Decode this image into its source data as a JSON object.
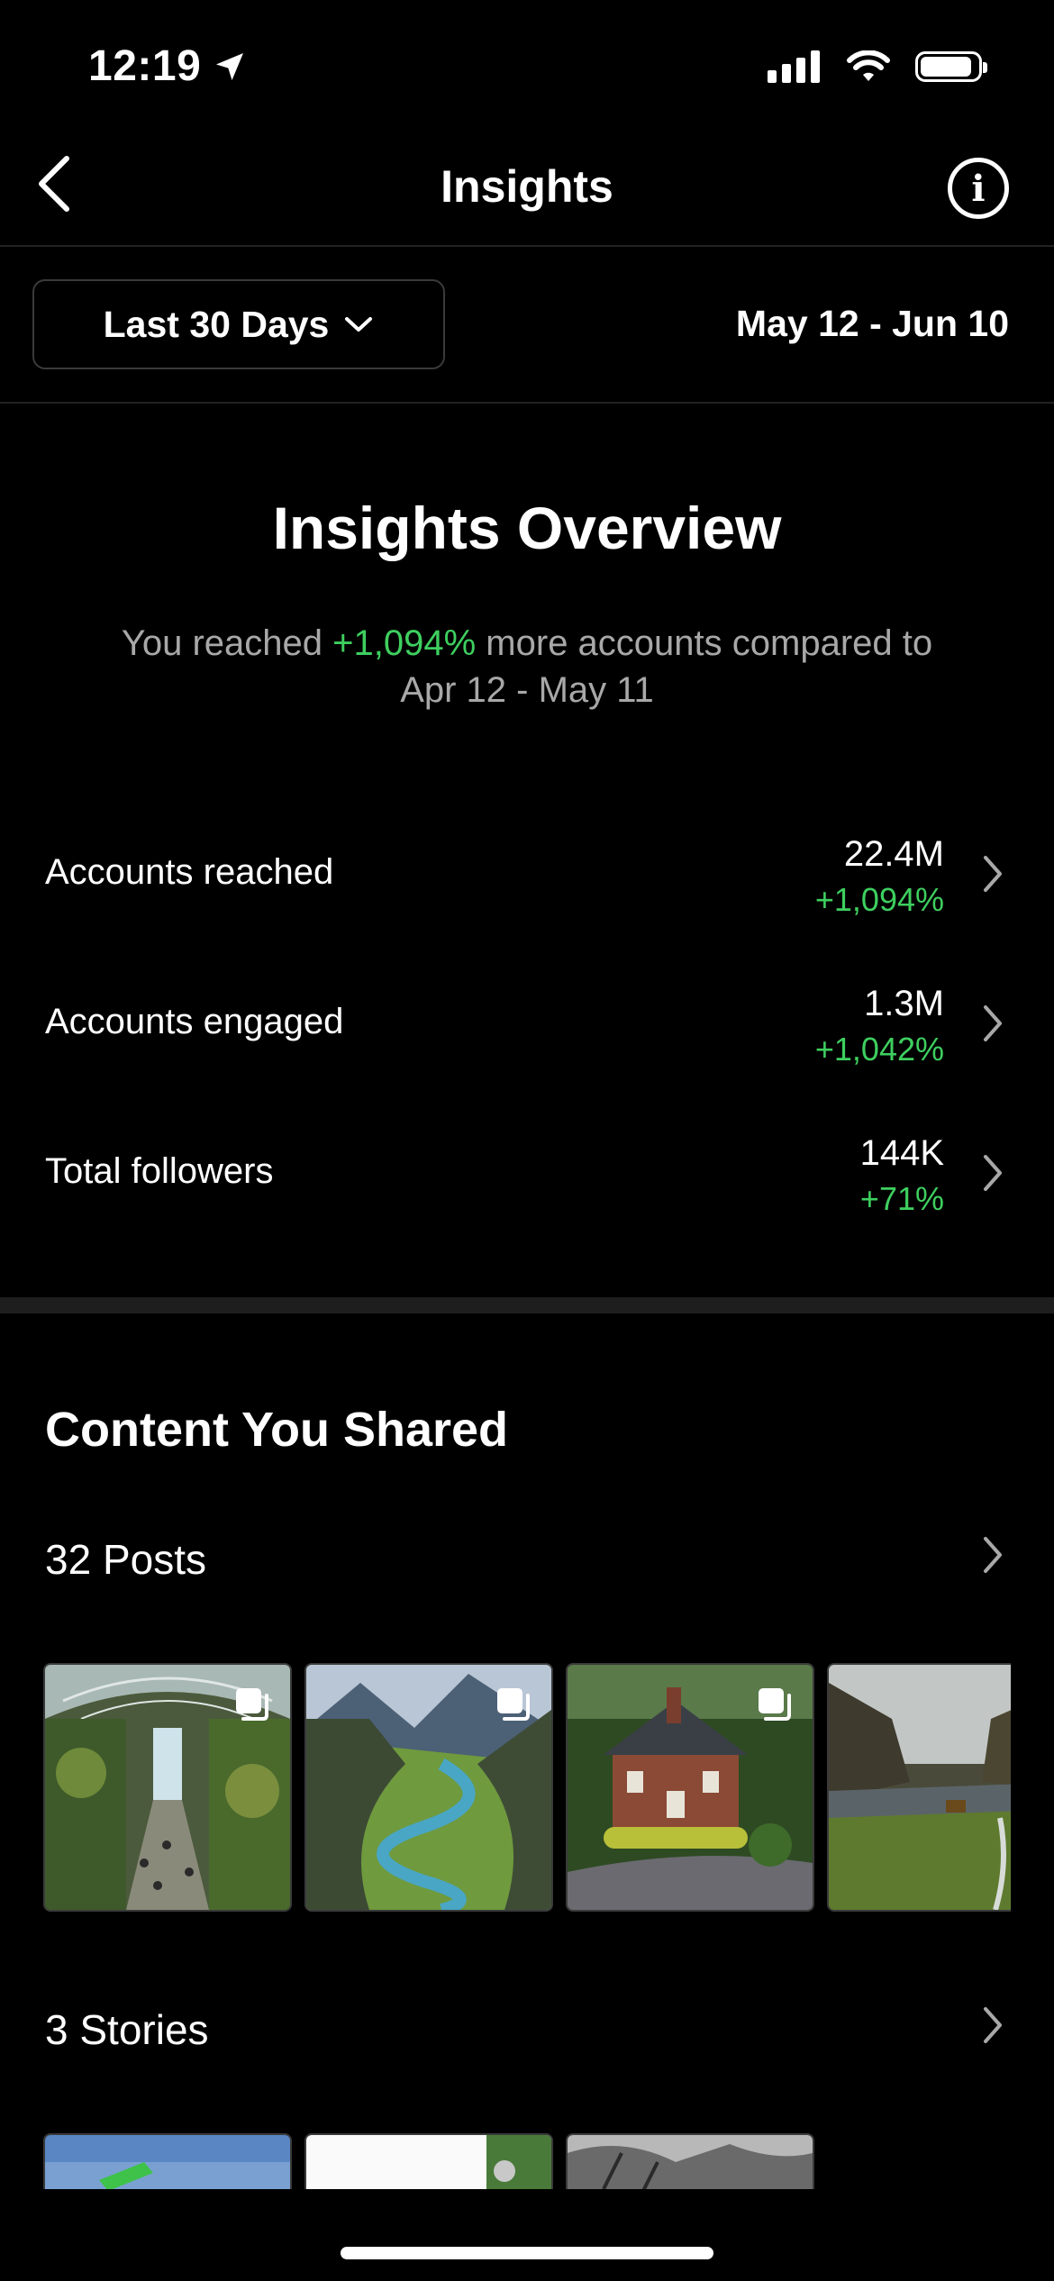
{
  "status_bar": {
    "time": "12:19"
  },
  "header": {
    "title": "Insights"
  },
  "filter": {
    "range_label": "Last 30 Days",
    "date_range": "May 12 - Jun 10"
  },
  "overview": {
    "title": "Insights Overview",
    "subtitle_prefix": "You reached ",
    "subtitle_highlight": "+1,094%",
    "subtitle_suffix": " more accounts compared to Apr 12 - May 11"
  },
  "metrics": [
    {
      "label": "Accounts reached",
      "value": "22.4M",
      "delta": "+1,094%"
    },
    {
      "label": "Accounts engaged",
      "value": "1.3M",
      "delta": "+1,042%"
    },
    {
      "label": "Total followers",
      "value": "144K",
      "delta": "+71%"
    }
  ],
  "content": {
    "title": "Content You Shared",
    "posts_label": "32 Posts",
    "stories_label": "3 Stories"
  },
  "colors": {
    "accent_green": "#3ecf5f",
    "muted_text": "#a8a8a8",
    "background": "#000000"
  }
}
